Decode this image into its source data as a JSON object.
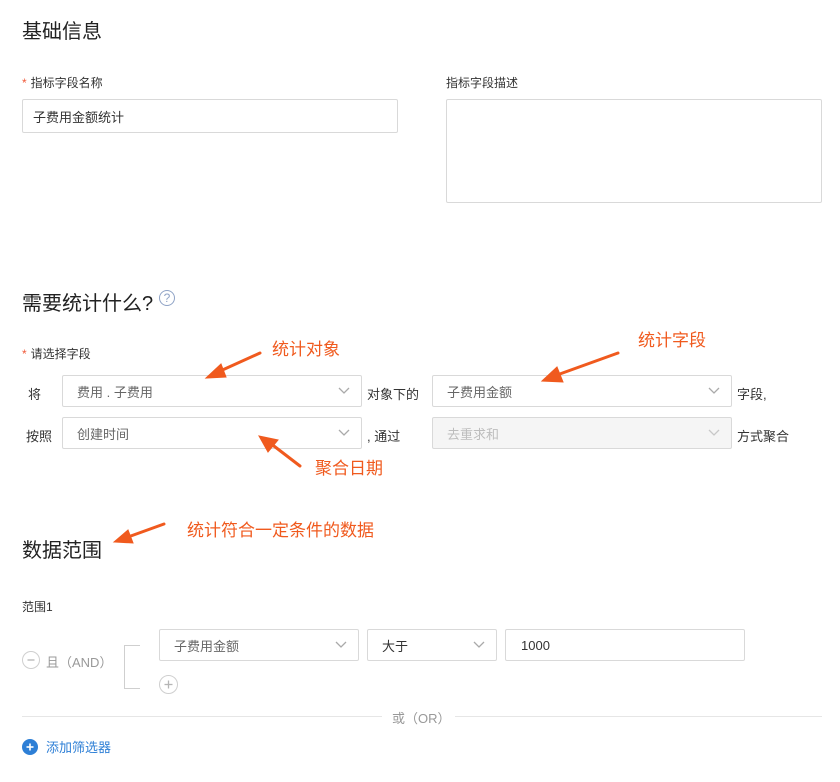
{
  "basic_info": {
    "title": "基础信息",
    "name_label": "指标字段名称",
    "required_mark": "*",
    "name_value": "子费用金额统计",
    "desc_label": "指标字段描述",
    "desc_value": ""
  },
  "stats": {
    "title": "需要统计什么?",
    "help_glyph": "?",
    "field_label": "请选择字段",
    "required_mark": "*",
    "row1": {
      "prefix": "将",
      "object_select": "费用 . 子费用",
      "mid": "对象下的",
      "field_select": "子费用金额",
      "suffix": "字段,"
    },
    "row2": {
      "prefix": "按照",
      "date_select": "创建时间",
      "mid": ", 通过",
      "agg_select": "去重求和",
      "suffix": "方式聚合"
    }
  },
  "annotations": {
    "object": "统计对象",
    "field": "统计字段",
    "date": "聚合日期",
    "range": "统计符合一定条件的数据"
  },
  "data_range": {
    "title": "数据范围",
    "range_label": "范围1",
    "and_label": "且（AND）",
    "condition": {
      "field": "子费用金额",
      "operator": "大于",
      "value": "1000"
    },
    "or_label": "或（OR）",
    "add_filter_label": "添加筛选器"
  },
  "colors": {
    "accent_red": "#f05a1e",
    "link_blue": "#2d7fd6",
    "border": "#d9d9d9"
  },
  "icons": [
    "help-icon",
    "chevron-down-icon",
    "minus-circle-icon",
    "plus-circle-icon",
    "plus-circle-filled-icon"
  ]
}
